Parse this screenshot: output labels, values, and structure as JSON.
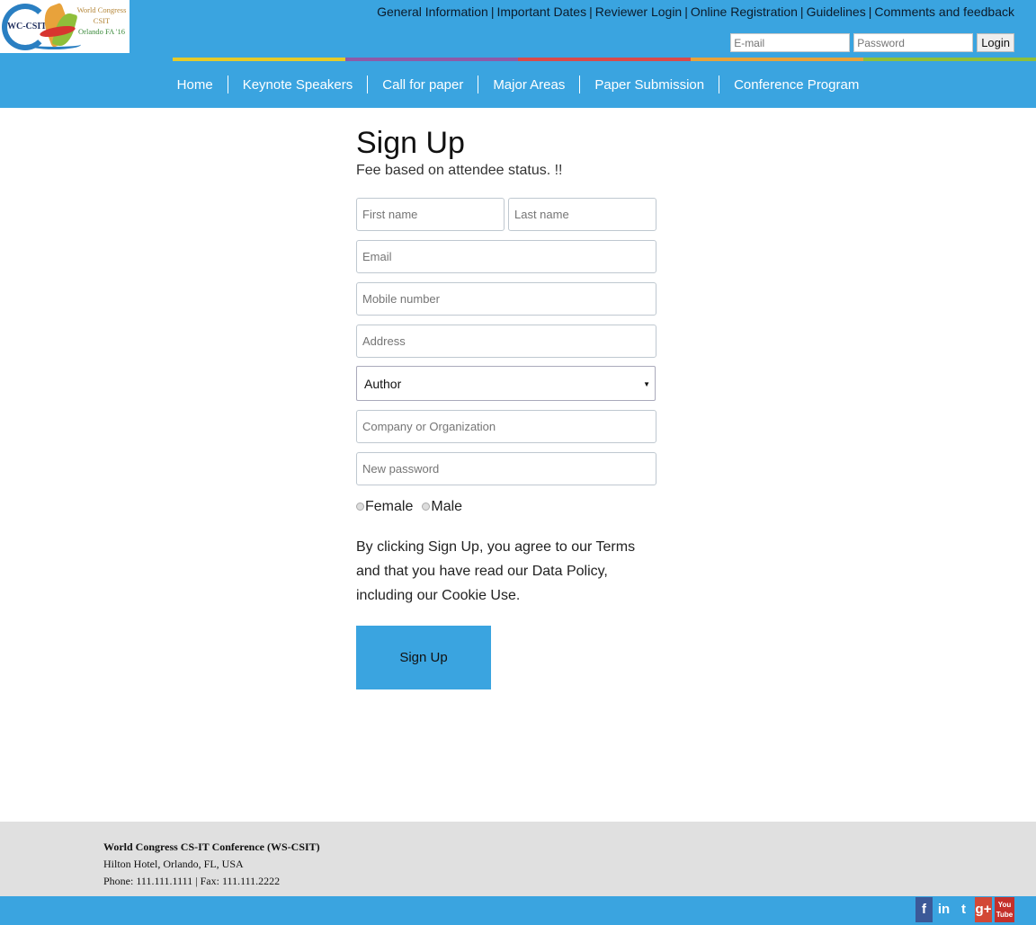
{
  "logo": {
    "abbr": "WC-CSIT",
    "line1": "World Congress",
    "line2": "CSIT",
    "line3": "Orlando FA '16"
  },
  "top_links": [
    {
      "label": "General Information"
    },
    {
      "label": "Important Dates"
    },
    {
      "label": "Reviewer Login"
    },
    {
      "label": "Online Registration"
    },
    {
      "label": "Guidelines"
    },
    {
      "label": "Comments and feedback"
    }
  ],
  "login": {
    "email_placeholder": "E-mail",
    "password_placeholder": "Password",
    "button_label": "Login"
  },
  "stripe_colors": [
    "#3aa4e0",
    "#e5cb2a",
    "#8e5aa8",
    "#d84a4a",
    "#e8a23b",
    "#8fbf3a"
  ],
  "nav": [
    {
      "label": "Home"
    },
    {
      "label": "Keynote Speakers"
    },
    {
      "label": "Call for paper"
    },
    {
      "label": "Major Areas"
    },
    {
      "label": "Paper Submission"
    },
    {
      "label": "Conference Program"
    }
  ],
  "form": {
    "title": "Sign Up",
    "subtitle": "Fee based on attendee status. !!",
    "first_name_placeholder": "First name",
    "last_name_placeholder": "Last name",
    "email_placeholder": "Email",
    "mobile_placeholder": "Mobile number",
    "address_placeholder": "Address",
    "status_selected": "Author",
    "company_placeholder": "Company or Organization",
    "password_placeholder": "New password",
    "gender_female": "Female",
    "gender_male": "Male",
    "terms": "By clicking Sign Up, you agree to our Terms and that you have read our Data Policy, including our Cookie Use.",
    "submit_label": "Sign Up"
  },
  "footer": {
    "org": "World Congress CS-IT Conference (WS-CSIT)",
    "address": "Hilton Hotel, Orlando, FL, USA",
    "contact": "Phone: 111.111.1111 | Fax: 111.111.2222"
  },
  "social": [
    {
      "icon": "facebook-icon",
      "glyph": "f",
      "color": "#3b5998"
    },
    {
      "icon": "linkedin-icon",
      "glyph": "in",
      "color": "#3aa4e0"
    },
    {
      "icon": "twitter-icon",
      "glyph": "t",
      "color": "#3aa4e0"
    },
    {
      "icon": "google-plus-icon",
      "glyph": "g+",
      "color": "#d34836"
    },
    {
      "icon": "youtube-icon",
      "glyph": "You Tube",
      "color": "#c4302b"
    }
  ]
}
